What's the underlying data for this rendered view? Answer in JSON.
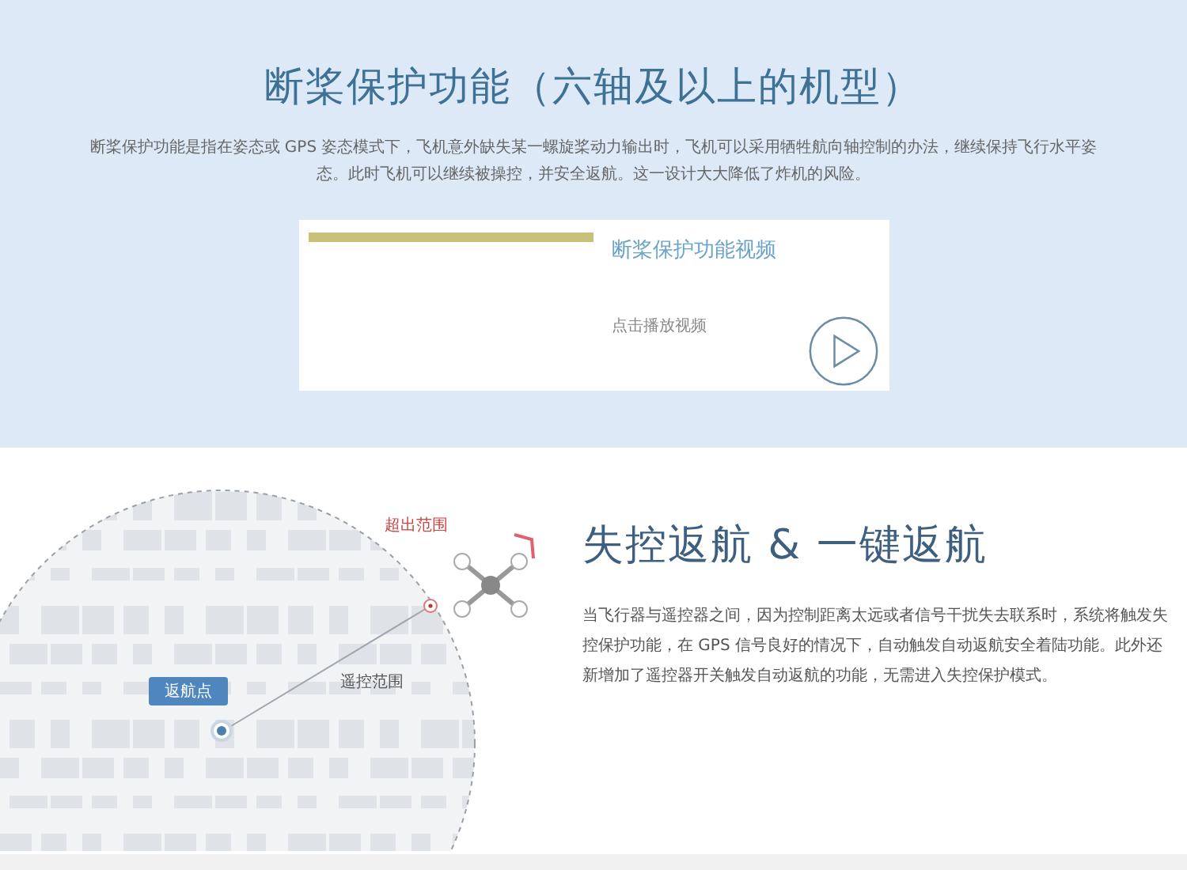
{
  "prop_section": {
    "title": "断桨保护功能（六轴及以上的机型）",
    "description": "断桨保护功能是指在姿态或 GPS 姿态模式下，飞机意外缺失某一螺旋桨动力输出时，飞机可以采用牺牲航向轴控制的办法，继续保持飞行水平姿态。此时飞机可以继续被操控，并安全返航。这一设计大大降低了炸机的风险。",
    "video_card": {
      "title": "断桨保护功能视频",
      "hint": "点击播放视频"
    }
  },
  "return_section": {
    "title": "失控返航 & 一键返航",
    "description": "当飞行器与遥控器之间，因为控制距离太远或者信号干扰失去联系时，系统将触发失控保护功能，在 GPS 信号良好的情况下，自动触发自动返航安全着陆功能。此外还新增加了遥控器开关触发自动返航的功能，无需进入失控保护模式。",
    "map_labels": {
      "out_of_range": "超出范围",
      "control_range": "遥控范围",
      "home_point": "返航点"
    }
  }
}
